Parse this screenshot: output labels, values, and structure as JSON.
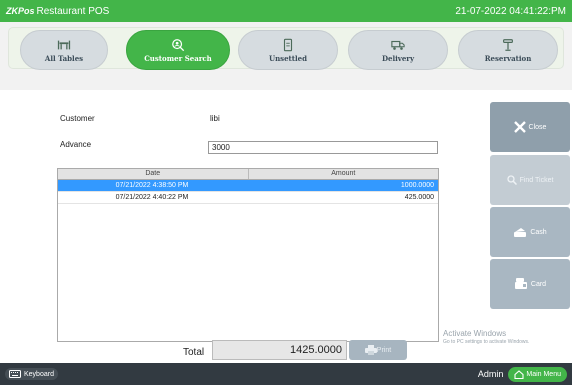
{
  "app": {
    "brand_prefix": "ZK",
    "brand_suffix": "Pos",
    "title": "Restaurant POS",
    "datetime": "21-07-2022 04:41:22:PM"
  },
  "nav": {
    "tabs": [
      {
        "label": "All Tables",
        "icon": "tables-icon",
        "active": false
      },
      {
        "label": "Customer Search",
        "icon": "customer-search-icon",
        "active": true
      },
      {
        "label": "Unsettled",
        "icon": "receipt-icon",
        "active": false
      },
      {
        "label": "Delivery",
        "icon": "delivery-icon",
        "active": false
      },
      {
        "label": "Reservation",
        "icon": "reservation-icon",
        "active": false
      }
    ]
  },
  "form": {
    "customer_label": "Customer",
    "customer_value": "libi",
    "advance_label": "Advance",
    "advance_value": "3000"
  },
  "grid": {
    "columns": [
      "Date",
      "Amount"
    ],
    "rows": [
      {
        "date": "07/21/2022 4:38:50 PM",
        "amount": "1000.0000",
        "selected": true
      },
      {
        "date": "07/21/2022 4:40:22 PM",
        "amount": "425.0000",
        "selected": false
      }
    ]
  },
  "footer": {
    "total_label": "Total",
    "total_value": "1425.0000",
    "print_label": "Print"
  },
  "side_buttons": {
    "close": "Close",
    "find_ticket": "Find Ticket",
    "cash": "Cash",
    "card": "Card"
  },
  "watermark": {
    "line1": "Activate Windows",
    "line2": "Go to PC settings to activate Windows."
  },
  "bottom": {
    "keyboard": "Keyboard",
    "user": "Admin",
    "main_menu": "Main Menu"
  },
  "colors": {
    "accent": "#43b549",
    "selection": "#3399ff",
    "button": "#a9b7c2",
    "bottom_bar": "#323a41"
  }
}
